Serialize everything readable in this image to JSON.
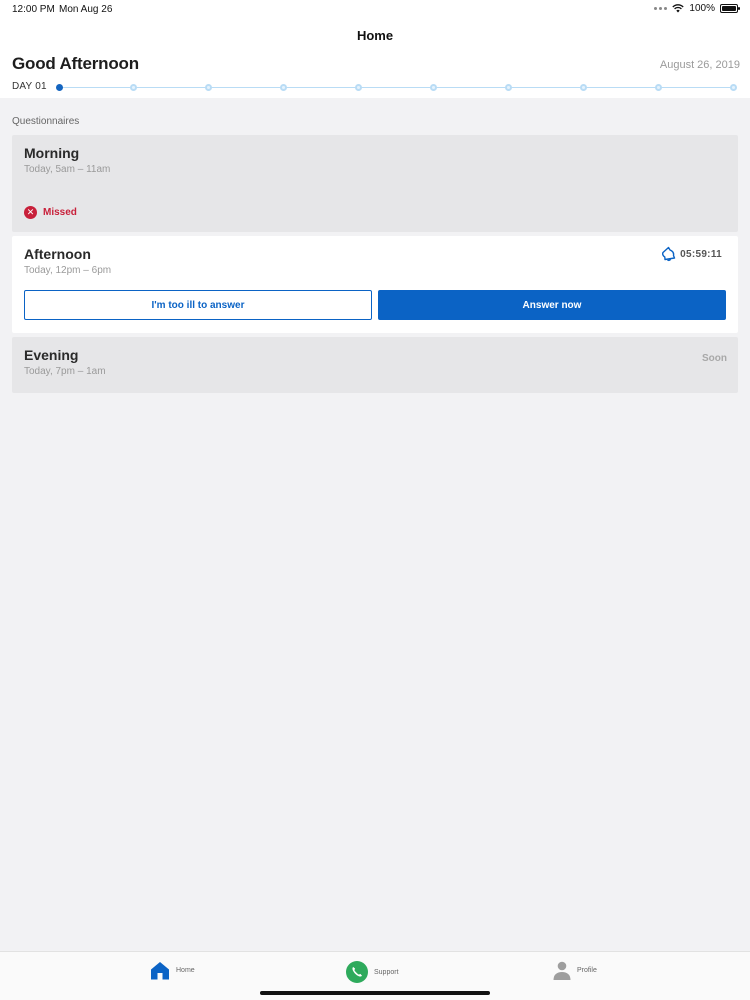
{
  "status_bar": {
    "time": "12:00 PM",
    "date": "Mon Aug 26",
    "battery": "100%"
  },
  "header": {
    "title": "Home"
  },
  "greeting": {
    "text": "Good Afternoon",
    "date": "August 26, 2019",
    "day_label": "DAY 01",
    "timeline": {
      "total_days": 10,
      "current_day": 1
    }
  },
  "questionnaires": {
    "section_label": "Questionnaires",
    "cards": [
      {
        "title": "Morning",
        "time": "Today, 5am – 11am",
        "status": "Missed"
      },
      {
        "title": "Afternoon",
        "time": "Today, 12pm – 6pm",
        "countdown": "05:59:11",
        "ill_button": "I'm too ill to answer",
        "answer_button": "Answer now"
      },
      {
        "title": "Evening",
        "time": "Today, 7pm – 1am",
        "status": "Soon"
      }
    ]
  },
  "tab_bar": {
    "items": [
      {
        "label": "Home",
        "icon": "home-icon",
        "active": true
      },
      {
        "label": "Support",
        "icon": "phone-icon"
      },
      {
        "label": "Profile",
        "icon": "person-icon"
      }
    ]
  },
  "colors": {
    "primary": "#0b63c5",
    "missed": "#c8203a",
    "support": "#2eaa5c",
    "timeline": "#b9dcf5"
  }
}
